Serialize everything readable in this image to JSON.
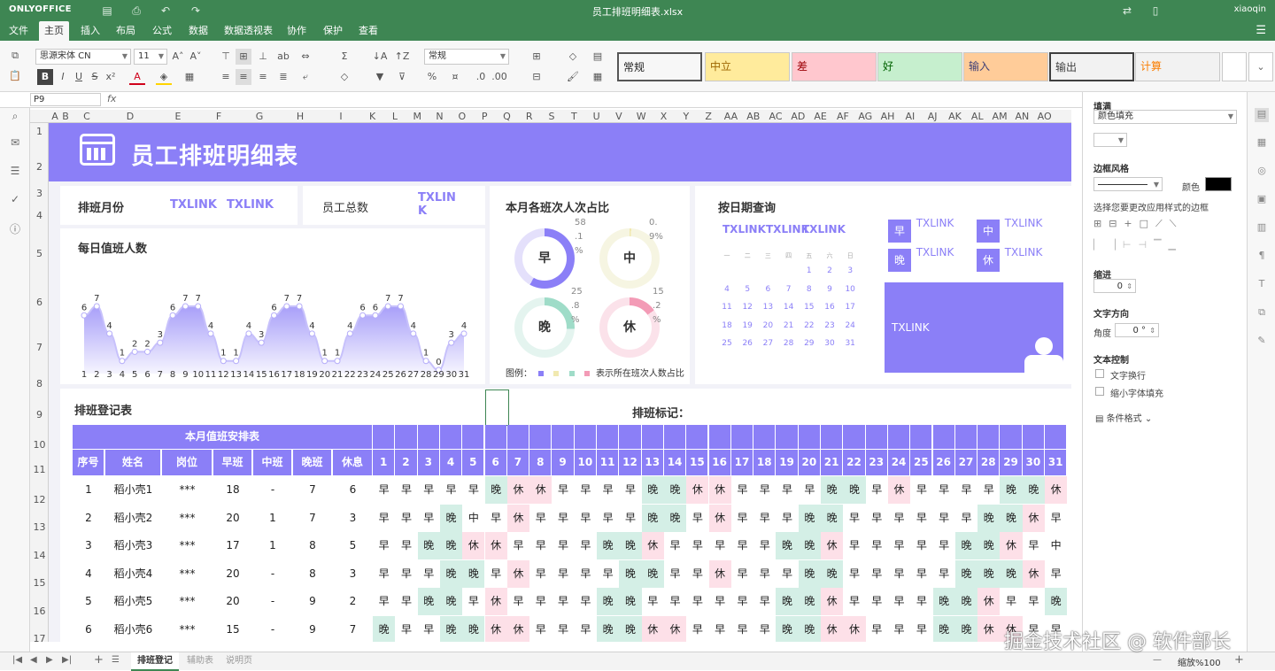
{
  "app": {
    "logo": "ONLYOFFICE",
    "doc_title": "员工排班明细表.xlsx",
    "user": "xiaoqin"
  },
  "menu": [
    "文件",
    "主页",
    "插入",
    "布局",
    "公式",
    "数据",
    "数据透视表",
    "协作",
    "保护",
    "查看"
  ],
  "ribbon": {
    "font_name": "思源宋体 CN",
    "font_size": "11",
    "number_format": "常规",
    "cell_styles": [
      {
        "label": "常规",
        "bg": "#ffffff",
        "fg": "#222222"
      },
      {
        "label": "中立",
        "bg": "#ffeb9c",
        "fg": "#9c6500"
      },
      {
        "label": "差",
        "bg": "#ffc7ce",
        "fg": "#9c0006"
      },
      {
        "label": "好",
        "bg": "#c6efce",
        "fg": "#006100"
      },
      {
        "label": "输入",
        "bg": "#ffcc99",
        "fg": "#3f3f76"
      },
      {
        "label": "输出",
        "bg": "#f2f2f2",
        "fg": "#3f3f3f"
      },
      {
        "label": "计算",
        "bg": "#f2f2f2",
        "fg": "#fa7d00"
      }
    ]
  },
  "formula_bar": {
    "name_box": "P9",
    "fx": "fx"
  },
  "columns": [
    "A",
    "B",
    "C",
    "D",
    "E",
    "F",
    "G",
    "H",
    "I",
    "K",
    "L",
    "M",
    "N",
    "O",
    "P",
    "Q",
    "R",
    "S",
    "T",
    "U",
    "V",
    "W",
    "X",
    "Y",
    "Z",
    "AA",
    "AB",
    "AC",
    "AD",
    "AE",
    "AF",
    "AG",
    "AH",
    "AI",
    "AJ",
    "AK",
    "AL",
    "AM",
    "AN",
    "AO"
  ],
  "rows": [
    "1",
    "2",
    "3",
    "4",
    "5",
    "6",
    "7",
    "8",
    "9",
    "10",
    "11",
    "12",
    "13",
    "14",
    "15",
    "16",
    "17"
  ],
  "dashboard": {
    "title": "员工排班明细表",
    "month_label": "排班月份",
    "month_values": [
      "TXLINK",
      "TXLINK"
    ],
    "total_label": "员工总数",
    "total_value": "TXLINK",
    "daily_title": "每日值班人数",
    "ratio_title": "本月各班次人次占比",
    "rings": [
      {
        "label": "早",
        "pct_lines": [
          "58",
          ".1",
          "%"
        ],
        "color": "#8b7ff7",
        "track": "#e4e0fb",
        "value": 0.581
      },
      {
        "label": "中",
        "pct_lines": [
          "0.",
          "9%"
        ],
        "color": "#f1e9b0",
        "track": "#f6f5e2",
        "value": 0.009
      },
      {
        "label": "晚",
        "pct_lines": [
          "25",
          ".8",
          "%"
        ],
        "color": "#9fdcc8",
        "track": "#e4f4ef",
        "value": 0.258
      },
      {
        "label": "休",
        "pct_lines": [
          "15",
          ".2",
          "%"
        ],
        "color": "#f39bb6",
        "track": "#fbe2ea",
        "value": 0.152
      }
    ],
    "legend_label": "图例：",
    "legend_text": "表示所在班次人数占比",
    "legend_colors": [
      "#8b7ff7",
      "#f1e9b0",
      "#9fdcc8",
      "#f39bb6"
    ],
    "date_title": "按日期查询",
    "date_values": [
      "TXLINK",
      "TXLINK",
      "TXLINK"
    ],
    "cal_head": [
      "一",
      "二",
      "三",
      "四",
      "五",
      "六",
      "日"
    ],
    "cal_days": [
      [
        null,
        null,
        null,
        null,
        "1",
        "2",
        "3"
      ],
      [
        "4",
        "5",
        "6",
        "7",
        "8",
        "9",
        "10"
      ],
      [
        "11",
        "12",
        "13",
        "14",
        "15",
        "16",
        "17"
      ],
      [
        "18",
        "19",
        "20",
        "21",
        "22",
        "23",
        "24"
      ],
      [
        "25",
        "26",
        "27",
        "28",
        "29",
        "30",
        "31"
      ]
    ],
    "query_boxes": [
      {
        "label": "早",
        "value": "TXLINK"
      },
      {
        "label": "中",
        "value": "TXLINK"
      },
      {
        "label": "晚",
        "value": "TXLINK"
      },
      {
        "label": "休",
        "value": "TXLINK"
      }
    ],
    "big_box_text": "TXLINK",
    "reg_title": "排班登记表",
    "mark_title": "排班标记：",
    "table_group": "本月值班安排表",
    "table_headers": [
      "序号",
      "姓名",
      "岗位",
      "早班",
      "中班",
      "晚班",
      "休息"
    ],
    "days": [
      "1",
      "2",
      "3",
      "4",
      "5",
      "6",
      "7",
      "8",
      "9",
      "10",
      "11",
      "12",
      "13",
      "14",
      "15",
      "16",
      "17",
      "18",
      "19",
      "20",
      "21",
      "22",
      "23",
      "24",
      "25",
      "26",
      "27",
      "28",
      "29",
      "30",
      "31"
    ],
    "table_rows": [
      {
        "cells": [
          "1",
          "稻小壳1",
          "***",
          "18",
          "-",
          "7",
          "6"
        ],
        "shifts": [
          "早",
          "早",
          "早",
          "早",
          "早",
          "晚",
          "休",
          "休",
          "早",
          "早",
          "早",
          "早",
          "晚",
          "晚",
          "休",
          "休",
          "早",
          "早",
          "早",
          "早",
          "晚",
          "晚",
          "早",
          "休",
          "早",
          "早",
          "早",
          "早",
          "晚",
          "晚",
          "休"
        ]
      },
      {
        "cells": [
          "2",
          "稻小壳2",
          "***",
          "20",
          "1",
          "7",
          "3"
        ],
        "shifts": [
          "早",
          "早",
          "早",
          "晚",
          "中",
          "早",
          "休",
          "早",
          "早",
          "早",
          "早",
          "早",
          "晚",
          "晚",
          "早",
          "休",
          "早",
          "早",
          "早",
          "晚",
          "晚",
          "早",
          "早",
          "早",
          "早",
          "早",
          "早",
          "晚",
          "晚",
          "休",
          "早"
        ]
      },
      {
        "cells": [
          "3",
          "稻小壳3",
          "***",
          "17",
          "1",
          "8",
          "5"
        ],
        "shifts": [
          "早",
          "早",
          "晚",
          "晚",
          "休",
          "休",
          "早",
          "早",
          "早",
          "早",
          "晚",
          "晚",
          "休",
          "早",
          "早",
          "早",
          "早",
          "早",
          "晚",
          "晚",
          "休",
          "早",
          "早",
          "早",
          "早",
          "早",
          "晚",
          "晚",
          "休",
          "早",
          "中"
        ]
      },
      {
        "cells": [
          "4",
          "稻小壳4",
          "***",
          "20",
          "-",
          "8",
          "3"
        ],
        "shifts": [
          "早",
          "早",
          "早",
          "晚",
          "晚",
          "早",
          "休",
          "早",
          "早",
          "早",
          "早",
          "晚",
          "晚",
          "早",
          "早",
          "休",
          "早",
          "早",
          "早",
          "晚",
          "晚",
          "早",
          "早",
          "早",
          "早",
          "早",
          "晚",
          "晚",
          "晚",
          "休",
          "早"
        ]
      },
      {
        "cells": [
          "5",
          "稻小壳5",
          "***",
          "20",
          "-",
          "9",
          "2"
        ],
        "shifts": [
          "早",
          "早",
          "晚",
          "晚",
          "早",
          "休",
          "早",
          "早",
          "早",
          "早",
          "晚",
          "晚",
          "早",
          "早",
          "早",
          "早",
          "早",
          "早",
          "晚",
          "晚",
          "休",
          "早",
          "早",
          "早",
          "早",
          "晚",
          "晚",
          "休",
          "早",
          "早",
          "晚"
        ]
      },
      {
        "cells": [
          "6",
          "稻小壳6",
          "***",
          "15",
          "-",
          "9",
          "7"
        ],
        "shifts": [
          "晚",
          "早",
          "早",
          "晚",
          "晚",
          "休",
          "休",
          "早",
          "早",
          "早",
          "晚",
          "晚",
          "休",
          "休",
          "早",
          "早",
          "早",
          "早",
          "晚",
          "晚",
          "休",
          "休",
          "早",
          "早",
          "早",
          "晚",
          "晚",
          "休",
          "休",
          "早",
          "早"
        ]
      }
    ],
    "shift_colors": {
      "早": "#ffffff",
      "中": "#ffffff",
      "晚": "#d4efe6",
      "休": "#fde0e8"
    }
  },
  "chart_data": {
    "type": "area",
    "title": "每日值班人数",
    "x": [
      1,
      2,
      3,
      4,
      5,
      6,
      7,
      8,
      9,
      10,
      11,
      12,
      13,
      14,
      15,
      16,
      17,
      18,
      19,
      20,
      21,
      22,
      23,
      24,
      25,
      26,
      27,
      28,
      29,
      30,
      31
    ],
    "values": [
      6,
      7,
      4,
      1,
      2,
      2,
      3,
      6,
      7,
      7,
      4,
      1,
      1,
      4,
      3,
      6,
      7,
      7,
      4,
      1,
      1,
      4,
      6,
      6,
      7,
      7,
      4,
      1,
      0,
      3,
      4
    ],
    "ylim": [
      0,
      7
    ],
    "color": "#8b7ff7"
  },
  "right_panel": {
    "fill_title": "填满",
    "fill_value": "颜色填充",
    "border_title": "边框风格",
    "color_label": "颜色",
    "border_hint": "选择您要更改应用样式的边框",
    "indent_title": "缩进",
    "indent_value": "0",
    "dir_title": "文字方向",
    "angle_label": "角度",
    "angle_value": "0 °",
    "text_ctrl_title": "文本控制",
    "wrap_label": "文字换行",
    "shrink_label": "缩小字体填充",
    "cond_label": "条件格式"
  },
  "status": {
    "tabs": [
      "排班登记",
      "辅助表",
      "说明页"
    ],
    "zoom": "缩放%100"
  },
  "watermark": "掘金技术社区 @ 软件部长"
}
